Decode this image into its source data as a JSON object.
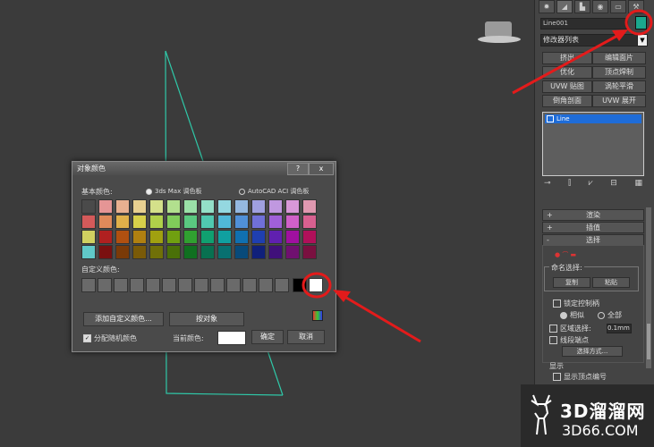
{
  "panel": {
    "tab_icons": [
      "create-icon",
      "modify-icon",
      "hierarchy-icon",
      "motion-icon",
      "display-icon",
      "utilities-icon"
    ],
    "object_name": "Line001",
    "object_color": "#1aa88e",
    "modifier_list": "修改器列表",
    "modifier_buttons": [
      "挤出",
      "编辑面片",
      "优化",
      "顶点焊制",
      "UVW 贴图",
      "涡轮平滑",
      "倒角剖面",
      "UVW 展开"
    ],
    "stack_item": "Line",
    "rollouts": {
      "sign_plus": "+",
      "sign_minus": "-",
      "render": "渲染",
      "interpolation": "插值",
      "selection": "选择"
    },
    "named_selection": "命名选择:",
    "copy": "复制",
    "paste": "粘贴",
    "lock_handles": "锁定控制柄",
    "similar": "相似",
    "all": "全部",
    "area_select": "区域选择:",
    "area_value": "0.1mm",
    "segment_end": "线段端点",
    "select_by": "选择方式...",
    "display": "显示",
    "show_vertex_numbers": "显示顶点编号"
  },
  "dialog": {
    "title": "对象颜色",
    "help": "?",
    "close": "x",
    "basic_colors_label": "基本颜色:",
    "radio_3dsmax": "3ds Max 调色板",
    "radio_autocad": "AutoCAD ACI 调色板",
    "custom_colors_label": "自定义颜色:",
    "add_custom": "添加自定义颜色...",
    "by_object": "按对象",
    "assign_random": "分配随机颜色",
    "current_color": "当前颜色:",
    "ok": "确定",
    "cancel": "取消",
    "palette": [
      [
        "#4a4a4a",
        "#e59595",
        "#e8b090",
        "#e8d090",
        "#d4e08a",
        "#b2e08e",
        "#9ae0a8",
        "#94e0c8",
        "#94d8e0",
        "#94b8e0",
        "#a0a0e0",
        "#c098e0",
        "#d898d8",
        "#e098b0"
      ],
      [
        "#d45a5a",
        "#e08a5a",
        "#e0b04a",
        "#d8d04a",
        "#b0d04a",
        "#80cc5a",
        "#5ac880",
        "#50c8b0",
        "#50b8d8",
        "#5090d8",
        "#7070d8",
        "#a060d8",
        "#d060c8",
        "#d86090"
      ],
      [
        "#d0d060",
        "#b02020",
        "#b05010",
        "#b08010",
        "#a0a010",
        "#70a010",
        "#30a030",
        "#10a070",
        "#10a0a0",
        "#1070b0",
        "#1f3fb0",
        "#6020b0",
        "#a010a0",
        "#b0105a"
      ],
      [
        "#60c8c8",
        "#7a1010",
        "#7a3a08",
        "#7a5a08",
        "#707008",
        "#4a7008",
        "#107020",
        "#087050",
        "#087070",
        "#084a7a",
        "#10207a",
        "#40107a",
        "#701070",
        "#7a1040"
      ]
    ]
  },
  "watermark": {
    "brand": "3D溜溜网",
    "domain": "3D66.COM"
  }
}
